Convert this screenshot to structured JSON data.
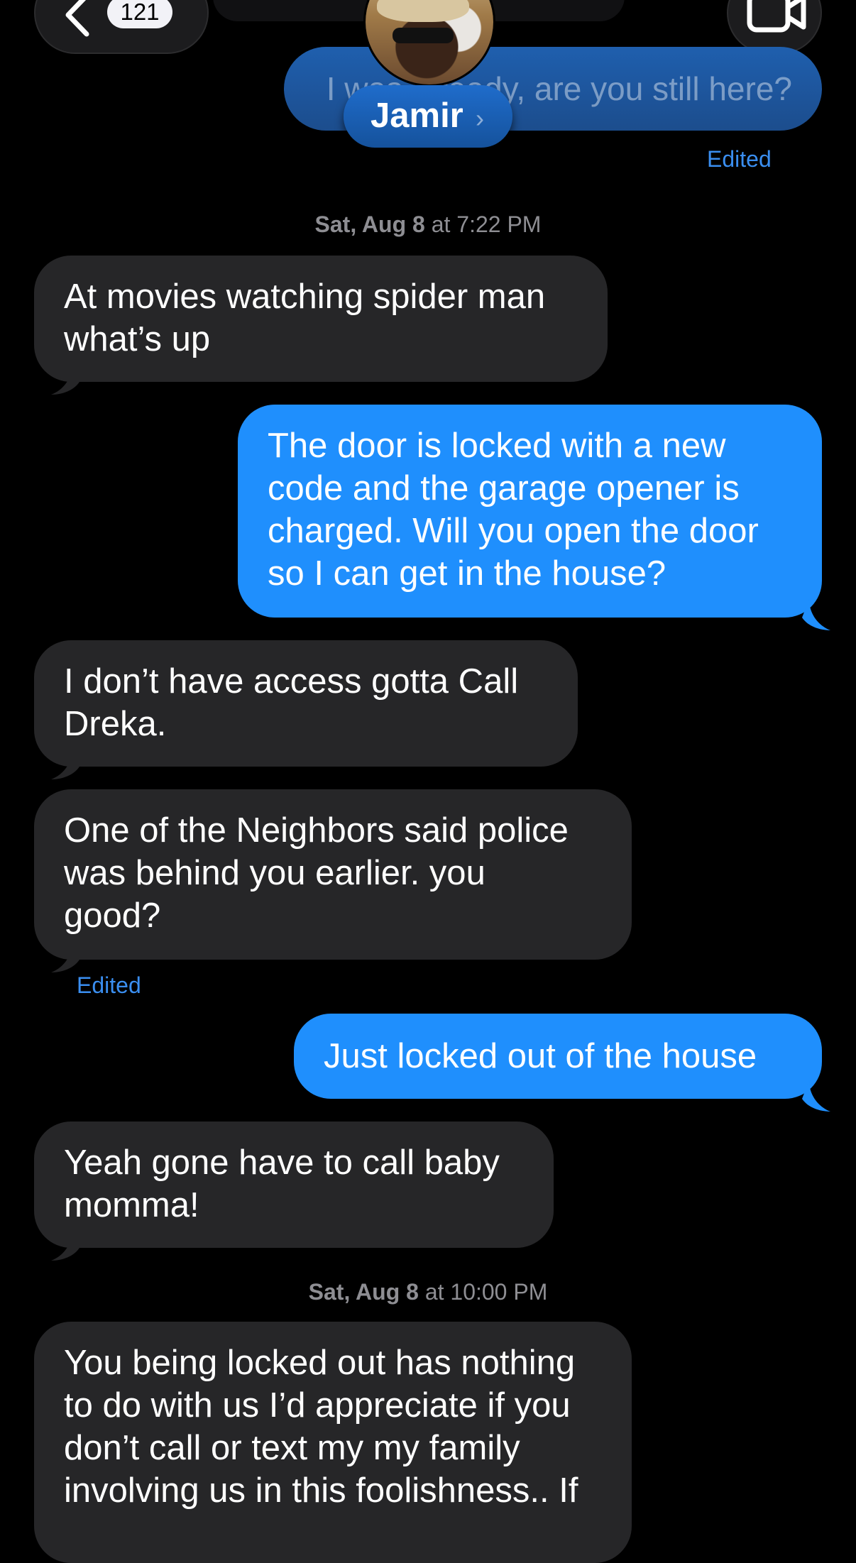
{
  "header": {
    "unread_count": "121",
    "contact_name": "Jamir",
    "contact_chevron": "›",
    "icons": {
      "back": "chevron-left-icon",
      "video": "video-camera-icon"
    }
  },
  "messages": {
    "first": {
      "text": "I was already, are you still here?",
      "note": "Edited"
    },
    "ts1": {
      "day": "Sat, Aug 8",
      "at": " at 7:22 PM"
    },
    "m1": "At movies watching spider man\nwhat’s up",
    "m2": "The door is locked with a new\ncode and the garage opener is\ncharged. Will you open the door\nso I can get in the house?",
    "m3": "I don’t have access gotta Call\nDreka.",
    "m4": "One of the Neighbors said police\nwas behind you earlier.  you\ngood?",
    "m4_note": "Edited",
    "m5": "Just locked out of the house",
    "m6": "Yeah gone have to call baby\nmomma!",
    "ts2": {
      "day": "Sat, Aug 8",
      "at": " at 10:00 PM"
    },
    "m7": "You being locked out has nothing\nto do with us I’d appreciate if you\ndon’t call or text my my family\ninvolving us in this foolishness.. If"
  },
  "colors": {
    "background": "#000000",
    "incoming_bubble": "#262628",
    "outgoing_bubble": "#1f8ffd",
    "edited_text": "#3a8ef0",
    "timestamp_text": "#8e8e93"
  }
}
